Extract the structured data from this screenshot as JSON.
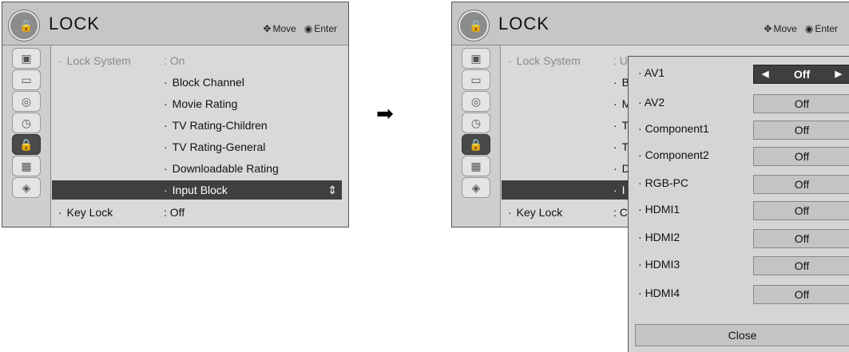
{
  "header": {
    "title": "LOCK",
    "move_label": "Move",
    "enter_label": "Enter"
  },
  "icons": {
    "lock": "lock-icon",
    "sidebar": [
      "picture-icon",
      "screen-icon",
      "audio-icon",
      "time-icon",
      "lock-icon",
      "option-icon",
      "setup-icon"
    ]
  },
  "left_menu": {
    "lock_system_label": "Lock System",
    "lock_system_value": ": On",
    "items": [
      "Block Channel",
      "Movie Rating",
      "TV Rating-Children",
      "TV Rating-General",
      "Downloadable Rating",
      "Input Block"
    ],
    "key_lock_label": "Key Lock",
    "key_lock_value": ": Off"
  },
  "right_menu": {
    "lock_system_label": "Lock System",
    "lock_system_value": ": U",
    "items": [
      "B",
      "M",
      "T",
      "T",
      "D",
      "I"
    ],
    "key_lock_label": "Key Lock",
    "key_lock_value": ": C"
  },
  "input_block": {
    "rows": [
      {
        "label": "AV1",
        "value": "Off"
      },
      {
        "label": "AV2",
        "value": "Off"
      },
      {
        "label": "Component1",
        "value": "Off"
      },
      {
        "label": "Component2",
        "value": "Off"
      },
      {
        "label": "RGB-PC",
        "value": "Off"
      },
      {
        "label": "HDMI1",
        "value": "Off"
      },
      {
        "label": "HDMI2",
        "value": "Off"
      },
      {
        "label": "HDMI3",
        "value": "Off"
      },
      {
        "label": "HDMI4",
        "value": "Off"
      }
    ],
    "close_label": "Close"
  },
  "colors": {
    "highlight": "#3f3f3f",
    "panel": "#d9d9d9",
    "header": "#c6c6c6"
  }
}
